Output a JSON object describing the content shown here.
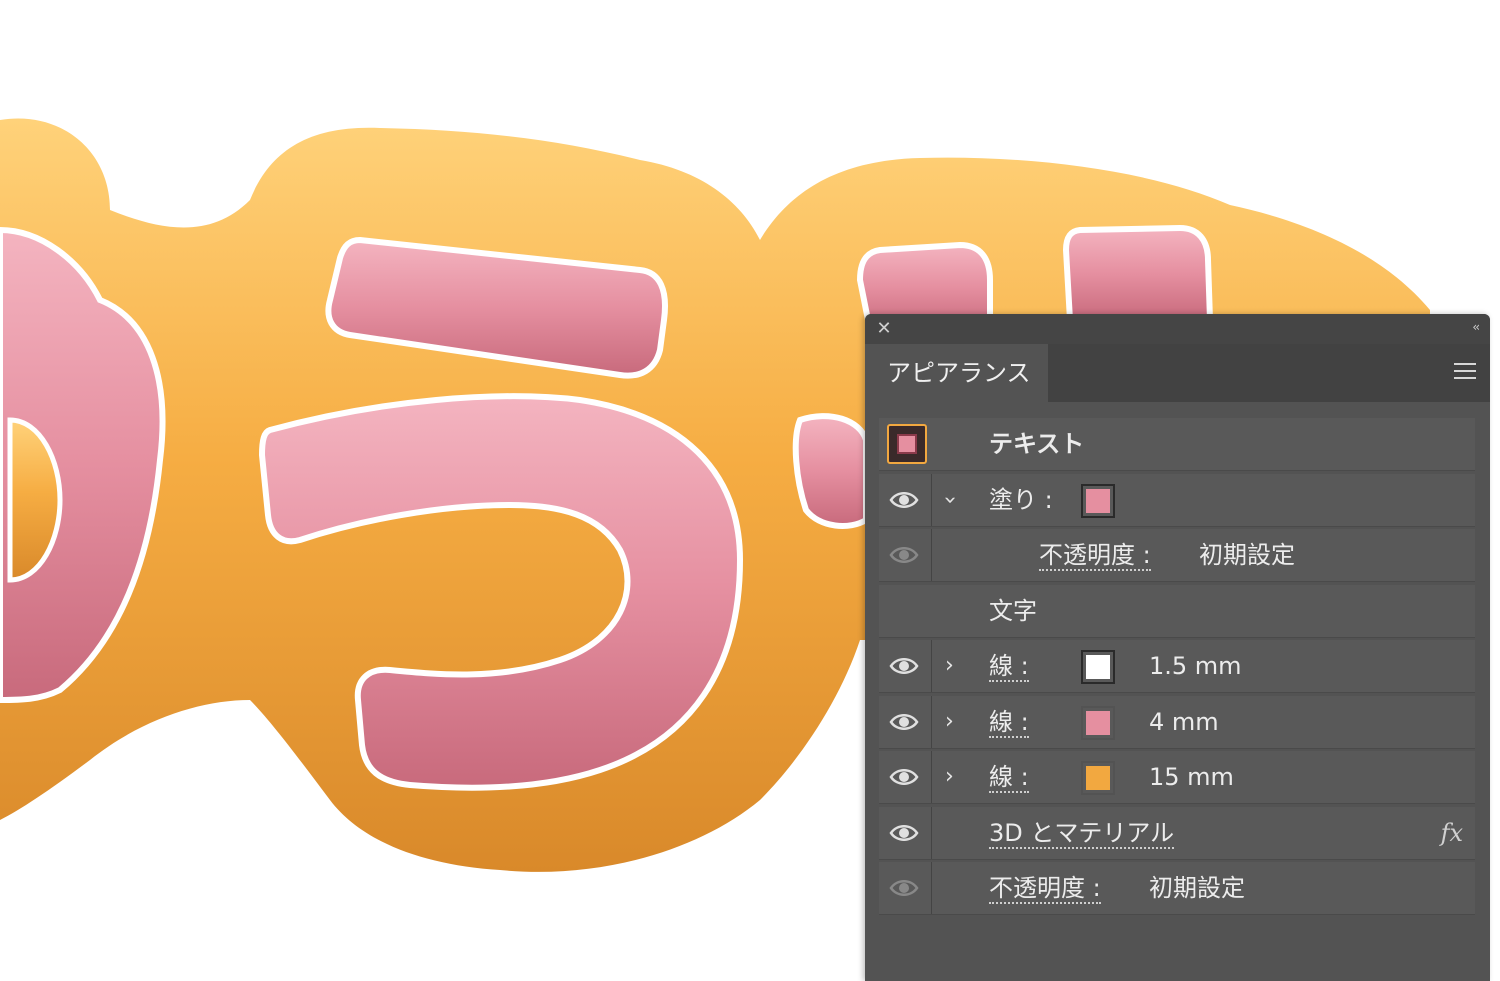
{
  "colors": {
    "orange": "#f2a840",
    "pink": "#e58fa0",
    "white": "#ffffff",
    "panel_bg": "#535353",
    "panel_dark": "#424242"
  },
  "artwork": {
    "glyphs": [
      "ゆ",
      "う",
      "い"
    ]
  },
  "panel": {
    "tab_label": "アピアランス",
    "header": {
      "title": "テキスト"
    },
    "fill_row": {
      "label": "塗り :",
      "swatch_color": "#e58fa0"
    },
    "fill_opacity": {
      "label": "不透明度 :",
      "value": "初期設定"
    },
    "text_group_label": "文字",
    "strokes": [
      {
        "label": "線 :",
        "swatch_color": "#ffffff",
        "value": "1.5 mm"
      },
      {
        "label": "線 :",
        "swatch_color": "#e58fa0",
        "value": "4 mm"
      },
      {
        "label": "線 :",
        "swatch_color": "#f2a840",
        "value": "15 mm"
      }
    ],
    "effect": {
      "label": "3D とマテリアル",
      "fx_icon": "fx"
    },
    "opacity": {
      "label": "不透明度 :",
      "value": "初期設定"
    }
  }
}
